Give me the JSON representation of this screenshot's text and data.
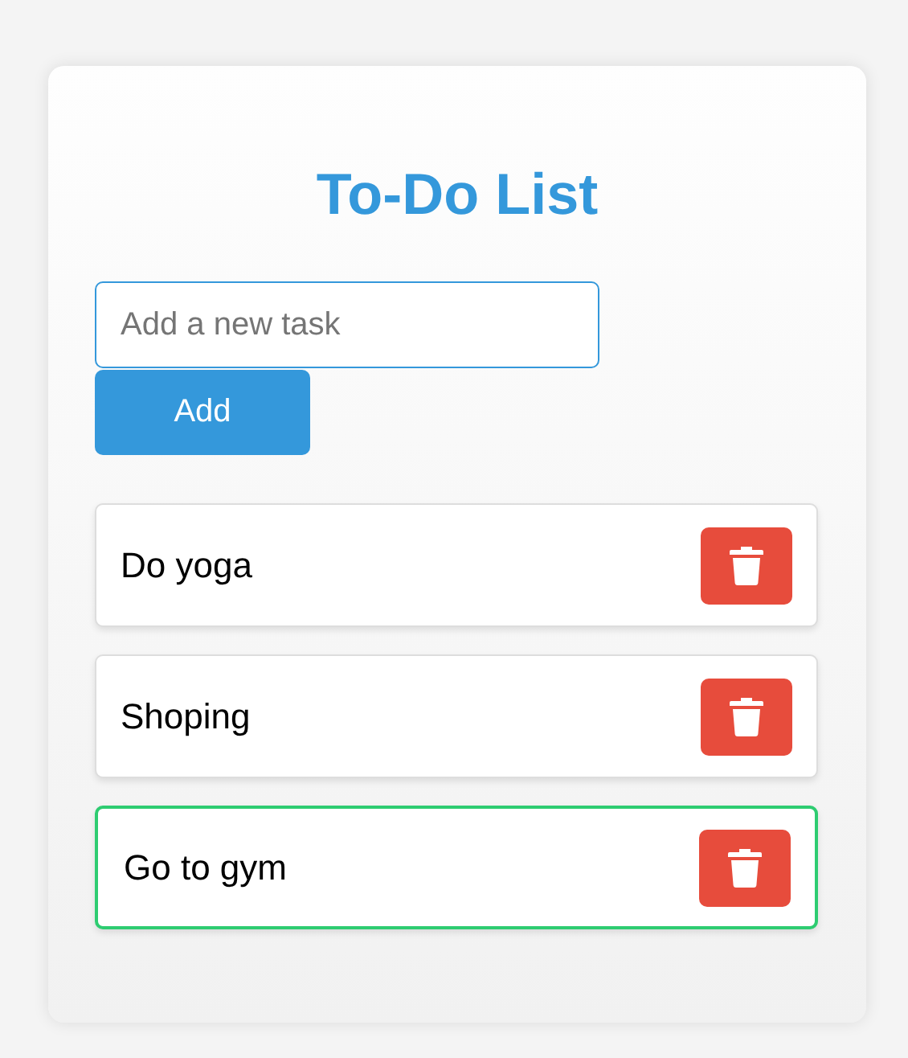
{
  "title": "To-Do List",
  "new_task": {
    "placeholder": "Add a new task"
  },
  "add_button": "Add",
  "tasks": [
    {
      "text": "Do yoga",
      "selected": false
    },
    {
      "text": "Shoping",
      "selected": false
    },
    {
      "text": "Go to gym",
      "selected": true
    }
  ]
}
